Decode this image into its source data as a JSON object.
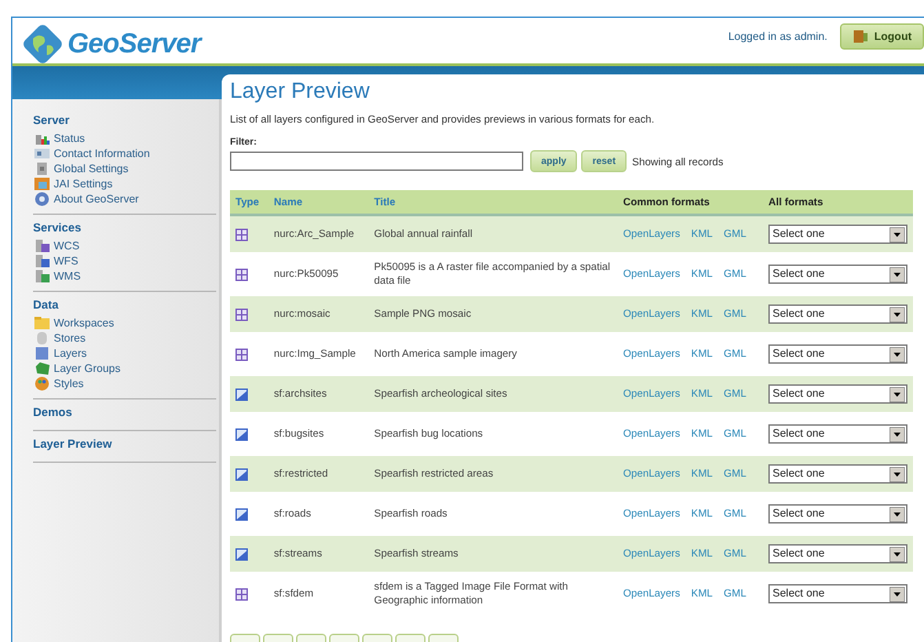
{
  "header": {
    "logo": "GeoServer",
    "login_text": "Logged in as admin.",
    "logout_button": "Logout"
  },
  "sidebar": {
    "sections": [
      {
        "title": "Server",
        "items": [
          {
            "label": "Status",
            "kind": "status"
          },
          {
            "label": "Contact Information",
            "kind": "contact"
          },
          {
            "label": "Global Settings",
            "kind": "global"
          },
          {
            "label": "JAI Settings",
            "kind": "jai"
          },
          {
            "label": "About GeoServer",
            "kind": "about"
          }
        ]
      },
      {
        "title": "Services",
        "items": [
          {
            "label": "WCS",
            "kind": "wcs"
          },
          {
            "label": "WFS",
            "kind": "wfs"
          },
          {
            "label": "WMS",
            "kind": "wms"
          }
        ]
      },
      {
        "title": "Data",
        "items": [
          {
            "label": "Workspaces",
            "kind": "workspace"
          },
          {
            "label": "Stores",
            "kind": "store"
          },
          {
            "label": "Layers",
            "kind": "layer"
          },
          {
            "label": "Layer Groups",
            "kind": "group"
          },
          {
            "label": "Styles",
            "kind": "style"
          }
        ]
      },
      {
        "title": "Demos"
      },
      {
        "title": "Layer Preview"
      }
    ]
  },
  "page": {
    "title": "Layer Preview",
    "description": "List of all layers configured in GeoServer and provides previews in various formats for each.",
    "filter": {
      "label": "Filter:",
      "apply_button": "apply",
      "reset_button": "reset",
      "status": "Showing all records"
    }
  },
  "table": {
    "columns": [
      "Type",
      "Name",
      "Title",
      "Common formats",
      "All formats"
    ],
    "rows": [
      {
        "kind": "raster",
        "name": "nurc:Arc_Sample",
        "title": "Global annual rainfall",
        "links": [
          "OpenLayers",
          "KML",
          "GML"
        ],
        "select": "Select one"
      },
      {
        "kind": "raster",
        "name": "nurc:Pk50095",
        "title": "Pk50095 is a A raster file accompanied by a spatial data file",
        "links": [
          "OpenLayers",
          "KML",
          "GML"
        ],
        "select": "Select one"
      },
      {
        "kind": "raster",
        "name": "nurc:mosaic",
        "title": "Sample PNG mosaic",
        "links": [
          "OpenLayers",
          "KML",
          "GML"
        ],
        "select": "Select one"
      },
      {
        "kind": "raster",
        "name": "nurc:Img_Sample",
        "title": "North America sample imagery",
        "links": [
          "OpenLayers",
          "KML",
          "GML"
        ],
        "select": "Select one"
      },
      {
        "kind": "vector",
        "name": "sf:archsites",
        "title": "Spearfish archeological sites",
        "links": [
          "OpenLayers",
          "KML",
          "GML"
        ],
        "select": "Select one"
      },
      {
        "kind": "vector",
        "name": "sf:bugsites",
        "title": "Spearfish bug locations",
        "links": [
          "OpenLayers",
          "KML",
          "GML"
        ],
        "select": "Select one"
      },
      {
        "kind": "vector",
        "name": "sf:restricted",
        "title": "Spearfish restricted areas",
        "links": [
          "OpenLayers",
          "KML",
          "GML"
        ],
        "select": "Select one"
      },
      {
        "kind": "vector",
        "name": "sf:roads",
        "title": "Spearfish roads",
        "links": [
          "OpenLayers",
          "KML",
          "GML"
        ],
        "select": "Select one"
      },
      {
        "kind": "vector",
        "name": "sf:streams",
        "title": "Spearfish streams",
        "links": [
          "OpenLayers",
          "KML",
          "GML"
        ],
        "select": "Select one"
      },
      {
        "kind": "raster",
        "name": "sf:sfdem",
        "title": "sfdem is a Tagged Image File Format with Geographic information",
        "links": [
          "OpenLayers",
          "KML",
          "GML"
        ],
        "select": "Select one"
      }
    ]
  }
}
